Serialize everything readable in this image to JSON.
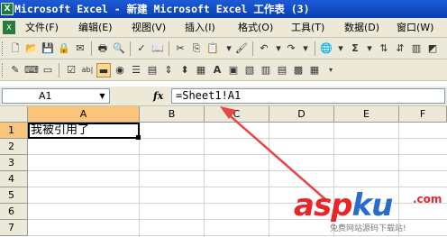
{
  "window": {
    "title": "Microsoft Excel - 新建 Microsoft Excel 工作表 (3)",
    "app_icon": "excel-icon"
  },
  "menubar": {
    "items": [
      "文件(F)",
      "编辑(E)",
      "视图(V)",
      "插入(I)",
      "格式(O)",
      "工具(T)",
      "数据(D)",
      "窗口(W)"
    ]
  },
  "toolbar": {
    "zoom_symbol": "Σ",
    "help_icon": "question-icon"
  },
  "formula_bar": {
    "name_box": "A1",
    "fx_label": "fx",
    "formula": "=Sheet1!A1"
  },
  "sheet": {
    "columns": [
      "A",
      "B",
      "C",
      "D",
      "E",
      "F"
    ],
    "rows": [
      "1",
      "2",
      "3",
      "4",
      "5",
      "6",
      "7"
    ],
    "active_cell": "A1",
    "cells": {
      "A1": "我被引用了"
    }
  },
  "annotation": {
    "arrow_color": "#e84545"
  },
  "watermark": {
    "logo_a": "asp",
    "logo_b": "ku",
    "tld": ".com",
    "tagline": "免费网站源码下载站!"
  }
}
